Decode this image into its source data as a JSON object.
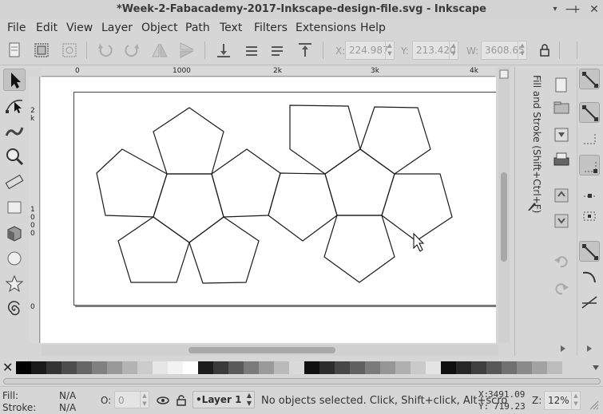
{
  "window": {
    "title": "*Week-2-Fabacademy-2017-Inkscape-design-file.svg - Inkscape",
    "controls": {
      "minimize": "−",
      "maximize": "+",
      "close": "✕",
      "menu": "▾"
    }
  },
  "menu": [
    "File",
    "Edit",
    "View",
    "Layer",
    "Object",
    "Path",
    "Text",
    "Filters",
    "Extensions",
    "Help"
  ],
  "toolbar": {
    "x_label": "X:",
    "x_value": "224.987",
    "y_label": "Y:",
    "y_value": "213.420",
    "w_label": "W:",
    "w_value": "3608.65"
  },
  "rulers": {
    "top": [
      "0",
      "1000",
      "2k",
      "3k",
      "4k"
    ],
    "left": [
      "2",
      "k",
      "1",
      "0",
      "0",
      "0",
      "0"
    ]
  },
  "dock": {
    "tab_label": "Fill and Stroke (Shift+Ctrl+F)"
  },
  "palette": {
    "none_symbol": "✕",
    "colors": [
      "#000000",
      "#1a1a1a",
      "#333333",
      "#4d4d4d",
      "#666666",
      "#808080",
      "#999999",
      "#b3b3b3",
      "#cccccc",
      "#e6e6e6",
      "#f2f2f2",
      "#ffffff",
      "#1c1c1c",
      "#3a3a3a",
      "#5a5a5a",
      "#7a7a7a",
      "#9a9a9a",
      "#bababa",
      "#dadada",
      "#111111",
      "#2c2c2c",
      "#464646",
      "#616161",
      "#7b7b7b",
      "#969696",
      "#b0b0b0",
      "#cacaca",
      "#e4e4e4",
      "#0f0f0f",
      "#262626",
      "#3f3f3f",
      "#585858",
      "#717171",
      "#8a8a8a",
      "#a3a3a3",
      "#bcbcbc"
    ]
  },
  "status": {
    "fill_label": "Fill:",
    "fill_value": "N/A",
    "stroke_label": "Stroke:",
    "stroke_value": "N/A",
    "opacity_label": "O:",
    "opacity_value": "0",
    "layer_name": "•Layer 1",
    "message": "No objects selected. Click, Shift+click, Alt+scro",
    "x_label": "X:",
    "x_value": "3491.09",
    "y_label": "Y:",
    "y_value": "719.23",
    "zoom_label": "Z:",
    "zoom_value": "12%"
  },
  "colors": {
    "chrome": "#d6d6d6",
    "canvas": "#ffffff",
    "stroke": "#1a1a1a"
  }
}
